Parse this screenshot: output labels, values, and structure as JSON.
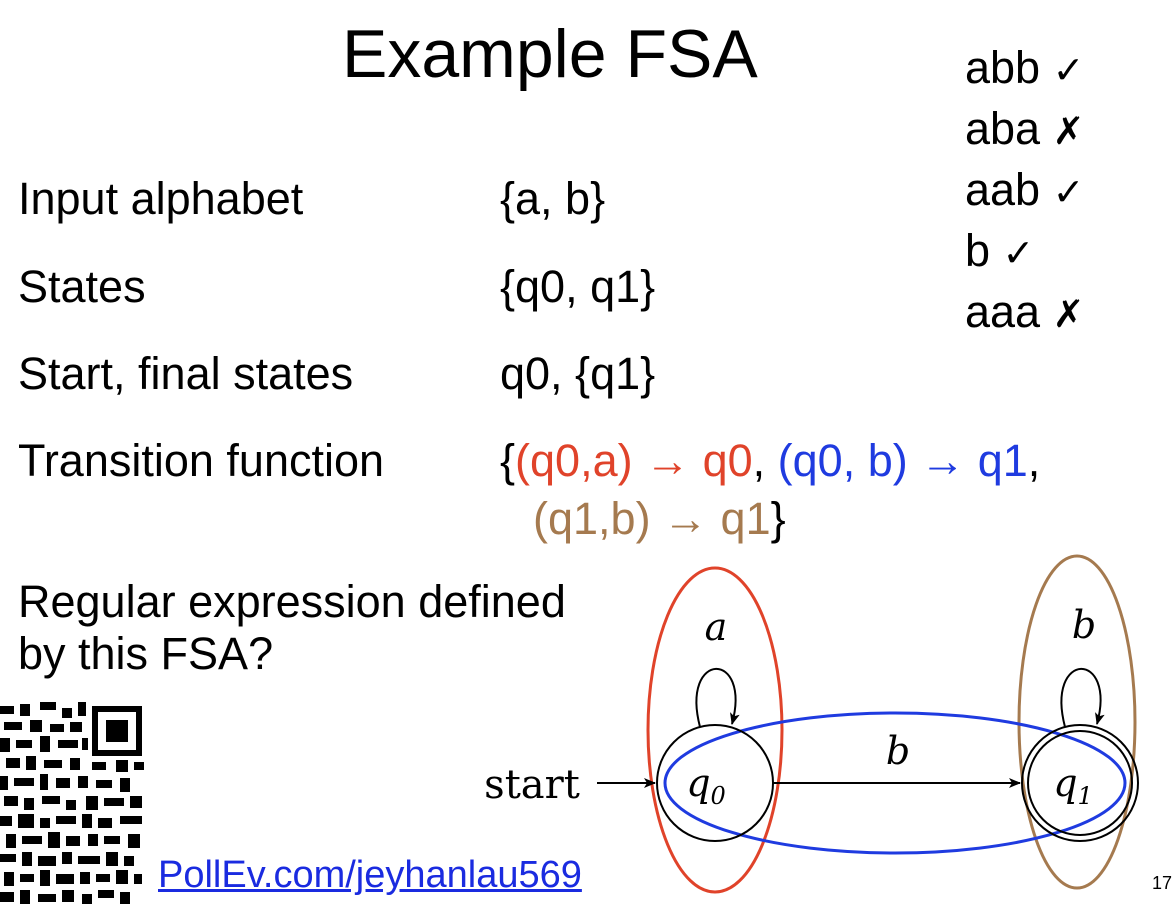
{
  "title": "Example FSA",
  "definitions": [
    {
      "label": "Input alphabet",
      "value": "{a, b}"
    },
    {
      "label": "States",
      "value": "{q0, q1}"
    },
    {
      "label": "Start, final states",
      "value": "q0, {q1}"
    },
    {
      "label": "Transition function"
    }
  ],
  "transition_function": {
    "open_brace": "{",
    "t1": "(q0,a) → q0",
    "sep1": ", ",
    "t2": "(q0, b) → q1",
    "sep2": ",",
    "t3": "(q1,b) → q1",
    "close_brace": "}"
  },
  "examples": [
    {
      "string": "abb",
      "mark": "✓"
    },
    {
      "string": "aba",
      "mark": "✗"
    },
    {
      "string": "aab",
      "mark": "✓"
    },
    {
      "string": "b",
      "mark": "✓"
    },
    {
      "string": "aaa",
      "mark": "✗"
    }
  ],
  "question": {
    "line1": "Regular expression defined",
    "line2": "by this FSA?"
  },
  "poll_link": "PollEv.com/jeyhanlau569",
  "page_number": "17",
  "diagram": {
    "start_label": "start",
    "state_q0": "q",
    "state_q0_sub": "0",
    "state_q1": "q",
    "state_q1_sub": "1",
    "edge_q0_loop": "a",
    "edge_q0_q1": "b",
    "edge_q1_loop": "b"
  },
  "colors": {
    "red": "#e0432a",
    "blue": "#1f3be0",
    "brown": "#a57a4f"
  }
}
